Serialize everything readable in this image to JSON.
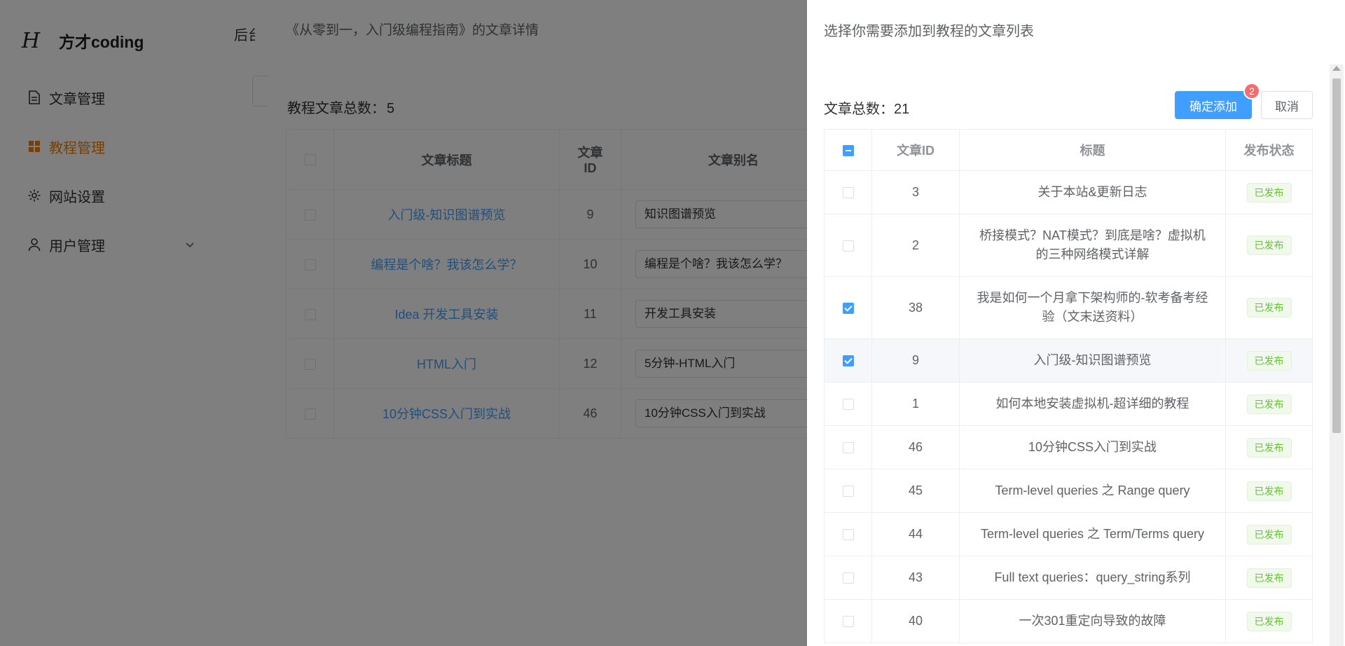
{
  "brand": {
    "name": "方才coding",
    "mark": "H"
  },
  "header": {
    "tab_label": "后台"
  },
  "sidebar": {
    "items": [
      {
        "label": "文章管理",
        "icon": "document-icon",
        "active": false
      },
      {
        "label": "教程管理",
        "icon": "grid-icon",
        "active": true
      },
      {
        "label": "网站设置",
        "icon": "gear-icon",
        "active": false
      },
      {
        "label": "用户管理",
        "icon": "user-icon",
        "active": false,
        "has_submenu": true
      }
    ]
  },
  "detail": {
    "title": "《从零到一，入门级编程指南》的文章详情",
    "count_label": "教程文章总数：",
    "count": "5",
    "columns": {
      "title": "文章标题",
      "id_line1": "文章",
      "id_line2": "ID",
      "alias": "文章别名"
    },
    "rows": [
      {
        "title": "入门级-知识图谱预览",
        "id": "9",
        "alias": "知识图谱预览"
      },
      {
        "title": "编程是个啥？我该怎么学？",
        "id": "10",
        "alias": "编程是个啥？我该怎么学？"
      },
      {
        "title": "Idea 开发工具安装",
        "id": "11",
        "alias": "开发工具安装"
      },
      {
        "title": "HTML入门",
        "id": "12",
        "alias": "5分钟-HTML入门"
      },
      {
        "title": "10分钟CSS入门到实战",
        "id": "46",
        "alias": "10分钟CSS入门到实战"
      }
    ]
  },
  "drawer": {
    "title": "选择你需要添加到教程的文章列表",
    "count_label": "文章总数：",
    "count": "21",
    "confirm_label": "确定添加",
    "cancel_label": "取消",
    "selected_badge": "2",
    "columns": {
      "id": "文章ID",
      "title": "标题",
      "status": "发布状态"
    },
    "rows": [
      {
        "id": "3",
        "title": "关于本站&更新日志",
        "status": "已发布",
        "checked": false
      },
      {
        "id": "2",
        "title": "桥接模式？NAT模式？到底是啥？虚拟机的三种网络模式详解",
        "status": "已发布",
        "checked": false,
        "tall": true
      },
      {
        "id": "38",
        "title": "我是如何一个月拿下架构师的-软考备考经验（文末送资料）",
        "status": "已发布",
        "checked": true,
        "tall": true
      },
      {
        "id": "9",
        "title": "入门级-知识图谱预览",
        "status": "已发布",
        "checked": true,
        "highlight": true
      },
      {
        "id": "1",
        "title": "如何本地安装虚拟机-超详细的教程",
        "status": "已发布",
        "checked": false
      },
      {
        "id": "46",
        "title": "10分钟CSS入门到实战",
        "status": "已发布",
        "checked": false
      },
      {
        "id": "45",
        "title": "Term-level queries 之 Range query",
        "status": "已发布",
        "checked": false
      },
      {
        "id": "44",
        "title": "Term-level queries 之 Term/Terms query",
        "status": "已发布",
        "checked": false
      },
      {
        "id": "43",
        "title": "Full text queries：query_string系列",
        "status": "已发布",
        "checked": false
      },
      {
        "id": "40",
        "title": "一次301重定向导致的故障",
        "status": "已发布",
        "checked": false
      }
    ]
  },
  "colors": {
    "primary": "#409eff",
    "active_menu": "#f57c00",
    "success": "#67c23a",
    "badge": "#f56c6c"
  }
}
